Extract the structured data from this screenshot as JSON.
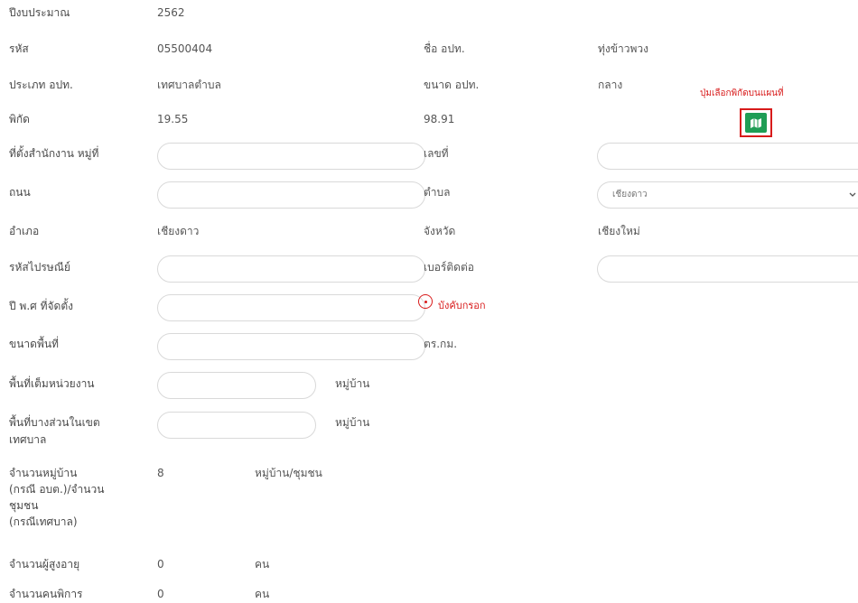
{
  "fields": {
    "fiscal_year": {
      "label": "ปีงบประมาณ",
      "value": "2562"
    },
    "code": {
      "label": "รหัส",
      "value": "05500404"
    },
    "org_name": {
      "label": "ชื่อ อปท.",
      "value": "ทุ่งข้าวพวง"
    },
    "org_type": {
      "label": "ประเภท อปท.",
      "value": "เทศบาลตำบล"
    },
    "org_size": {
      "label": "ขนาด อปท.",
      "value": "กลาง"
    },
    "coordinates": {
      "label": "พิกัด",
      "lat": "19.55",
      "lng": "98.91"
    },
    "office_village": {
      "label": "ที่ตั้งสำนักงาน หมู่ที่",
      "value": ""
    },
    "house_no": {
      "label": "เลขที่",
      "value": ""
    },
    "road": {
      "label": "ถนน",
      "value": ""
    },
    "subdistrict": {
      "label": "ตำบล",
      "selected": "เชียงดาว"
    },
    "district": {
      "label": "อำเภอ",
      "value": "เชียงดาว"
    },
    "province": {
      "label": "จังหวัด",
      "value": "เชียงใหม่"
    },
    "postal_code": {
      "label": "รหัสไปรษณีย์",
      "value": ""
    },
    "phone": {
      "label": "เบอร์ติดต่อ",
      "value": ""
    },
    "established_year": {
      "label": "ปี พ.ศ ที่จัดตั้ง",
      "value": "",
      "required_note": "บังคับกรอก"
    },
    "area": {
      "label": "ขนาดพื้นที่",
      "value": "",
      "unit": "ตร.กม."
    },
    "full_area": {
      "label": "พื้นที่เต็มหน่วยงาน",
      "value": "",
      "unit": "หมู่บ้าน"
    },
    "partial_area": {
      "label": "พื้นที่บางส่วนในเขต",
      "label2": "เทศบาล",
      "value": "",
      "unit": "หมู่บ้าน"
    },
    "village_count": {
      "label": "จำนวนหมู่บ้าน",
      "label2": "(กรณี อบต.)/จำนวน",
      "label3": "ชุมชน",
      "label4": "(กรณีเทศบาล)",
      "value": "8",
      "unit": "หมู่บ้าน/ชุมชน"
    },
    "elderly_count": {
      "label": "จำนวนผู้สูงอายุ",
      "value": "0",
      "unit": "คน"
    },
    "disabled_count": {
      "label": "จำนวนคนพิการ",
      "value": "0",
      "unit": "คน"
    }
  },
  "map_picker": {
    "hint": "ปุ่มเลือกพิกัดบนแผนที่",
    "icon": "map-icon"
  },
  "colors": {
    "accent_red": "#d81b1b",
    "map_green": "#1f9d55"
  }
}
